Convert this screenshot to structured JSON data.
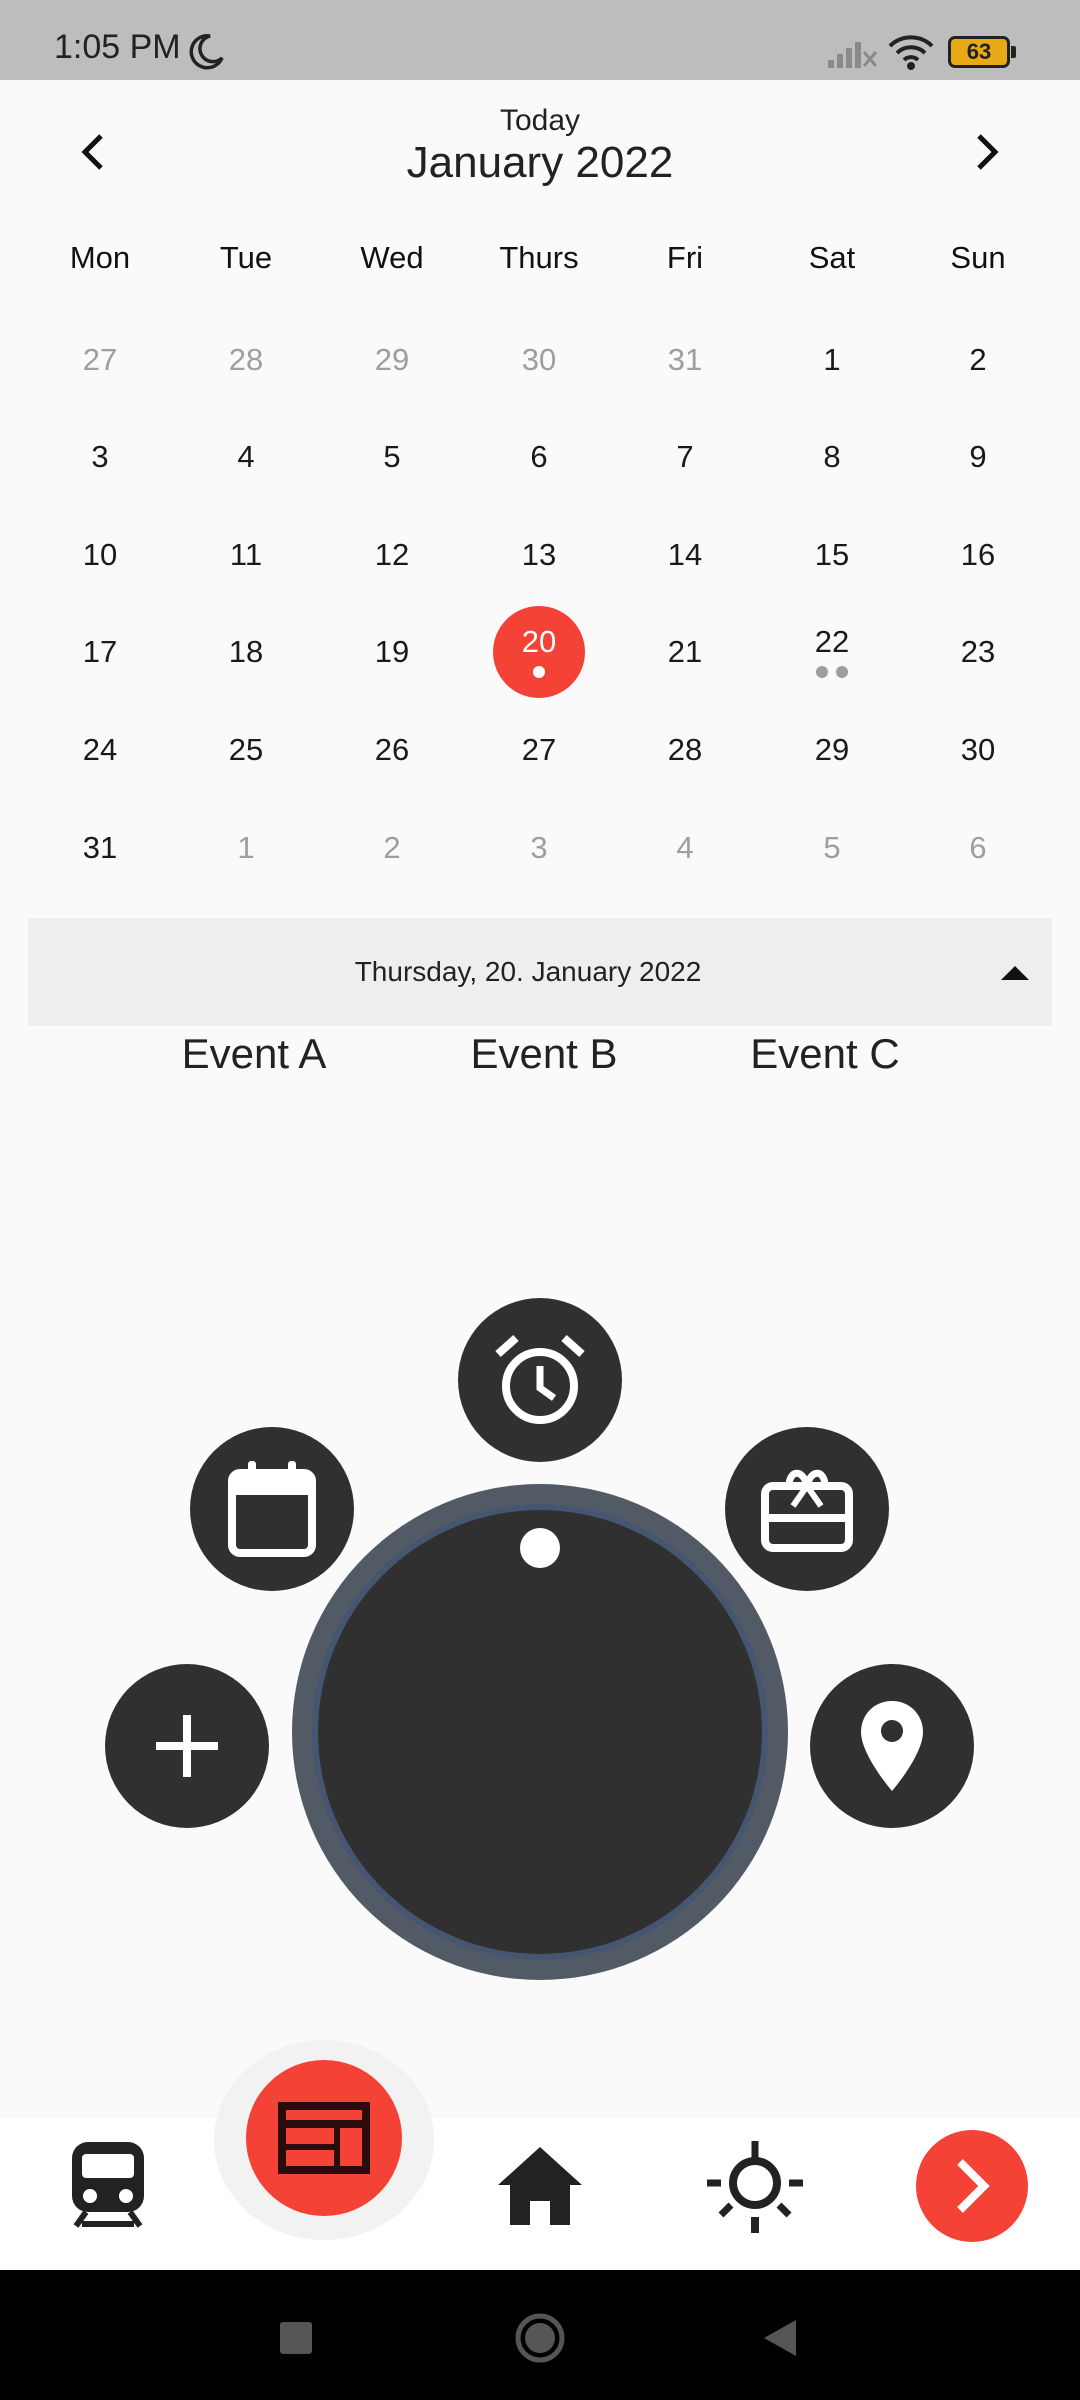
{
  "status_bar": {
    "time": "1:05 PM",
    "battery_level": "63",
    "icons": [
      "moon-icon",
      "signal-icon",
      "wifi-icon",
      "battery-icon"
    ]
  },
  "header": {
    "today_label": "Today",
    "month_title": "January 2022",
    "prev_icon": "chevron-left-icon",
    "next_icon": "chevron-right-icon"
  },
  "weekdays": [
    "Mon",
    "Tue",
    "Wed",
    "Thurs",
    "Fri",
    "Sat",
    "Sun"
  ],
  "weeks": [
    [
      "27",
      "28",
      "29",
      "30",
      "31",
      "1",
      "2"
    ],
    [
      "3",
      "4",
      "5",
      "6",
      "7",
      "8",
      "9"
    ],
    [
      "10",
      "11",
      "12",
      "13",
      "14",
      "15",
      "16"
    ],
    [
      "17",
      "18",
      "19",
      "20",
      "21",
      "22",
      "23"
    ],
    [
      "24",
      "25",
      "26",
      "27",
      "28",
      "29",
      "30"
    ],
    [
      "31",
      "1",
      "2",
      "3",
      "4",
      "5",
      "6"
    ]
  ],
  "selected_day": "20",
  "selected_date_label": "Thursday, 20. January 2022",
  "events": [
    "Event A",
    "Event B",
    "Event C"
  ],
  "radial_menu": {
    "items": [
      "add-icon",
      "calendar-icon",
      "alarm-icon",
      "gift-card-icon",
      "location-pin-icon"
    ]
  },
  "bottom_nav": {
    "items": [
      "train-icon",
      "dashboard-icon",
      "home-icon",
      "lightbulb-icon",
      "forward-arrow-icon"
    ],
    "active": "dashboard-icon"
  },
  "colors": {
    "accent": "#f44336",
    "dark": "#303030",
    "ring": "#465670",
    "status_bar": "#bdbdbd"
  }
}
